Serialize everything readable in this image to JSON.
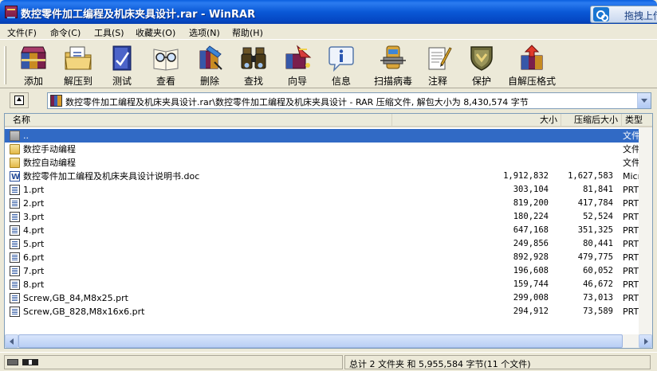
{
  "window": {
    "title": "数控零件加工编程及机床夹具设计.rar - WinRAR",
    "drag_extension_label": "拖拽上传"
  },
  "menu": [
    {
      "label": "文件(F)"
    },
    {
      "label": "命令(C)"
    },
    {
      "label": "工具(S)"
    },
    {
      "label": "收藏夹(O)"
    },
    {
      "label": "选项(N)"
    },
    {
      "label": "帮助(H)"
    }
  ],
  "toolbar": [
    {
      "label": "添加",
      "icon": "add-books-icon"
    },
    {
      "label": "解压到",
      "icon": "extract-folder-icon"
    },
    {
      "label": "测试",
      "icon": "test-book-icon"
    },
    {
      "label": "查看",
      "icon": "view-glasses-icon"
    },
    {
      "label": "删除",
      "icon": "delete-icon"
    },
    {
      "label": "查找",
      "icon": "binoculars-icon"
    },
    {
      "label": "向导",
      "icon": "wizard-icon"
    },
    {
      "label": "信息",
      "icon": "info-icon"
    },
    {
      "label": "扫描病毒",
      "icon": "scan-virus-icon"
    },
    {
      "label": "注释",
      "icon": "comment-icon"
    },
    {
      "label": "保护",
      "icon": "shield-icon"
    },
    {
      "label": "自解压格式",
      "icon": "sfx-icon"
    }
  ],
  "address": {
    "text": "数控零件加工编程及机床夹具设计.rar\\数控零件加工编程及机床夹具设计 - RAR 压缩文件, 解包大小为 8,430,574 字节"
  },
  "columns": {
    "name": "名称",
    "size": "大小",
    "packed": "压缩后大小",
    "type": "类型"
  },
  "files": [
    {
      "name": "..",
      "size": "",
      "packed": "",
      "type": "文件夹",
      "icon": "folder-up-icon",
      "selected": true
    },
    {
      "name": "数控手动编程",
      "size": "",
      "packed": "",
      "type": "文件夹",
      "icon": "folder-icon"
    },
    {
      "name": "数控自动编程",
      "size": "",
      "packed": "",
      "type": "文件夹",
      "icon": "folder-icon"
    },
    {
      "name": "数控零件加工编程及机床夹具设计说明书.doc",
      "size": "1,912,832",
      "packed": "1,627,583",
      "type": "Micros",
      "icon": "word-doc-icon"
    },
    {
      "name": "1.prt",
      "size": "303,104",
      "packed": "81,841",
      "type": "PRT 文",
      "icon": "prt-file-icon"
    },
    {
      "name": "2.prt",
      "size": "819,200",
      "packed": "417,784",
      "type": "PRT 文",
      "icon": "prt-file-icon"
    },
    {
      "name": "3.prt",
      "size": "180,224",
      "packed": "52,524",
      "type": "PRT 文",
      "icon": "prt-file-icon"
    },
    {
      "name": "4.prt",
      "size": "647,168",
      "packed": "351,325",
      "type": "PRT 文",
      "icon": "prt-file-icon"
    },
    {
      "name": "5.prt",
      "size": "249,856",
      "packed": "80,441",
      "type": "PRT 文",
      "icon": "prt-file-icon"
    },
    {
      "name": "6.prt",
      "size": "892,928",
      "packed": "479,775",
      "type": "PRT 文",
      "icon": "prt-file-icon"
    },
    {
      "name": "7.prt",
      "size": "196,608",
      "packed": "60,052",
      "type": "PRT 文",
      "icon": "prt-file-icon"
    },
    {
      "name": "8.prt",
      "size": "159,744",
      "packed": "46,672",
      "type": "PRT 文",
      "icon": "prt-file-icon"
    },
    {
      "name": "Screw,GB_84,M8x25.prt",
      "size": "299,008",
      "packed": "73,013",
      "type": "PRT 文",
      "icon": "prt-file-icon"
    },
    {
      "name": "Screw,GB_828,M8x16x6.prt",
      "size": "294,912",
      "packed": "73,589",
      "type": "PRT 文",
      "icon": "prt-file-icon"
    }
  ],
  "status": {
    "summary": "总计 2 文件夹 和 5,955,584 字节(11 个文件)"
  },
  "colors": {
    "titlebar": "#0a58d6",
    "selection": "#316ac5",
    "face": "#ece9d8"
  }
}
